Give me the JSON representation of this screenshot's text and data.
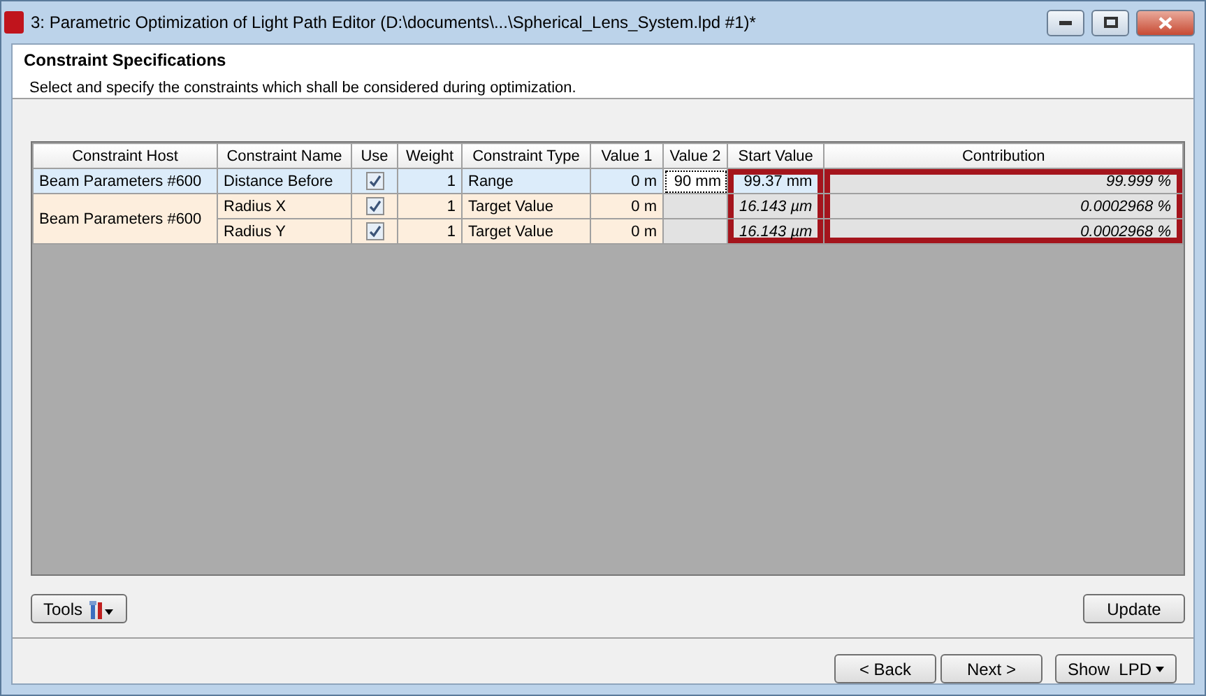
{
  "window": {
    "title": "3: Parametric Optimization of Light Path Editor (D:\\documents\\...\\Spherical_Lens_System.lpd #1)*"
  },
  "header": {
    "title": "Constraint Specifications",
    "description": "Select and specify the constraints which shall be considered during optimization."
  },
  "table": {
    "columns": [
      {
        "label": "Constraint Host",
        "highlighted": false
      },
      {
        "label": "Constraint Name",
        "highlighted": false
      },
      {
        "label": "Use",
        "highlighted": false
      },
      {
        "label": "Weight",
        "highlighted": false
      },
      {
        "label": "Constraint Type",
        "highlighted": false
      },
      {
        "label": "Value 1",
        "highlighted": false
      },
      {
        "label": "Value 2",
        "highlighted": false
      },
      {
        "label": "Start Value",
        "highlighted": true
      },
      {
        "label": "Contribution",
        "highlighted": true
      }
    ],
    "groups": [
      {
        "host": "Beam Parameters #600",
        "rows": [
          {
            "name": "Distance Before",
            "use": true,
            "weight": "1",
            "type": "Range",
            "value_1": "0 m",
            "value_2": "90 mm",
            "start_value": "99.37 mm",
            "contribution": "99.999 %",
            "selected": true
          }
        ]
      },
      {
        "host": "Beam Parameters #600",
        "rows": [
          {
            "name": "Radius X",
            "use": true,
            "weight": "1",
            "type": "Target Value",
            "value_1": "0 m",
            "start_value": "16.143 µm",
            "contribution": "0.0002968 %",
            "selected": false
          },
          {
            "name": "Radius Y",
            "use": true,
            "weight": "1",
            "type": "Target Value",
            "value_1": "0 m",
            "start_value": "16.143 µm",
            "contribution": "0.0002968 %",
            "selected": false
          }
        ]
      }
    ]
  },
  "tools_button": "Tools",
  "update_button": "Update",
  "nav_buttons": [
    "< Back",
    "Next >"
  ],
  "show_button": "Show  LPD"
}
